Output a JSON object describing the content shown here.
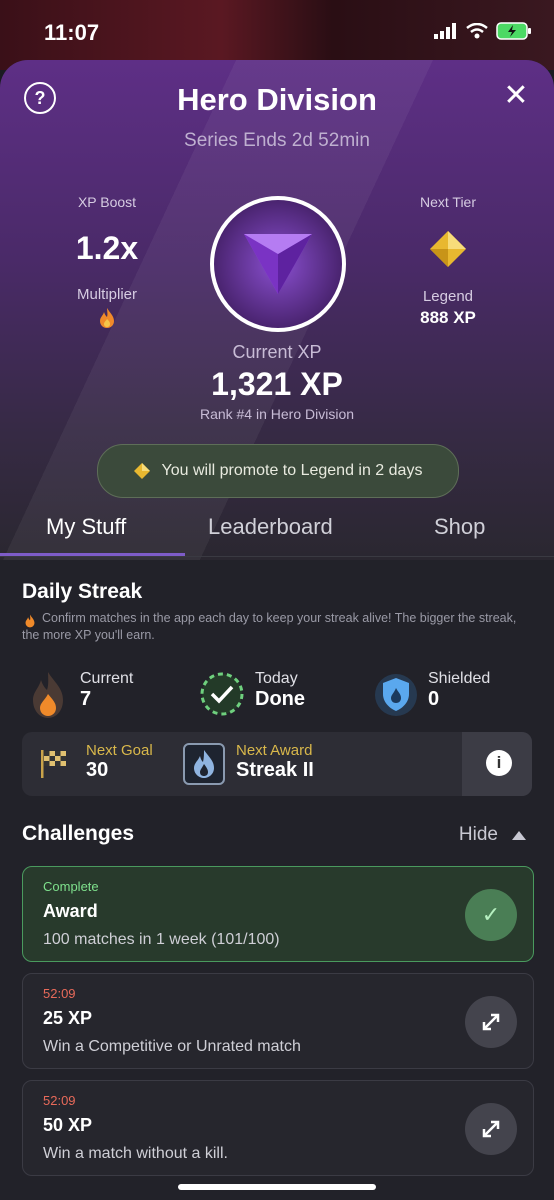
{
  "status_bar": {
    "time": "11:07"
  },
  "header": {
    "title": "Hero Division",
    "subtitle": "Series Ends 2d 52min",
    "help_icon": "question-circle-icon",
    "close_icon": "close-icon"
  },
  "xp_boost": {
    "label": "XP Boost",
    "value": "1.2x",
    "sub_label": "Multiplier"
  },
  "next_tier": {
    "label": "Next Tier",
    "name": "Legend",
    "xp": "888 XP"
  },
  "current_xp": {
    "label": "Current XP",
    "value": "1,321 XP",
    "rank": "Rank #4 in Hero Division"
  },
  "promo_banner": {
    "text": "You will promote to Legend in 2 days"
  },
  "tabs": [
    {
      "label": "My Stuff",
      "active": true
    },
    {
      "label": "Leaderboard",
      "active": false
    },
    {
      "label": "Shop",
      "active": false
    }
  ],
  "daily_streak": {
    "title": "Daily Streak",
    "description": "Confirm matches in the app each day to keep your streak alive! The bigger the streak, the more XP you'll earn.",
    "stats": [
      {
        "label": "Current",
        "value": "7",
        "icon": "flame-icon"
      },
      {
        "label": "Today",
        "value": "Done",
        "icon": "check-circle-icon"
      },
      {
        "label": "Shielded",
        "value": "0",
        "icon": "shield-icon"
      }
    ],
    "next_goal": {
      "label": "Next Goal",
      "value": "30"
    },
    "next_award": {
      "label": "Next Award",
      "value": "Streak II"
    }
  },
  "challenges": {
    "title": "Challenges",
    "hide_label": "Hide",
    "items": [
      {
        "status": "Complete",
        "title": "Award",
        "description": "100 matches in 1 week (101/100)",
        "complete": true
      },
      {
        "status": "52:09",
        "title": "25 XP",
        "description": "Win a Competitive or Unrated match",
        "complete": false
      },
      {
        "status": "52:09",
        "title": "50 XP",
        "description": "Win a match without a kill.",
        "complete": false
      }
    ]
  },
  "colors": {
    "accent_purple": "#7e5cc8",
    "complete_green": "#4a9a5e",
    "timer_red": "#e86a5a",
    "goal_gold": "#d9b84b"
  }
}
